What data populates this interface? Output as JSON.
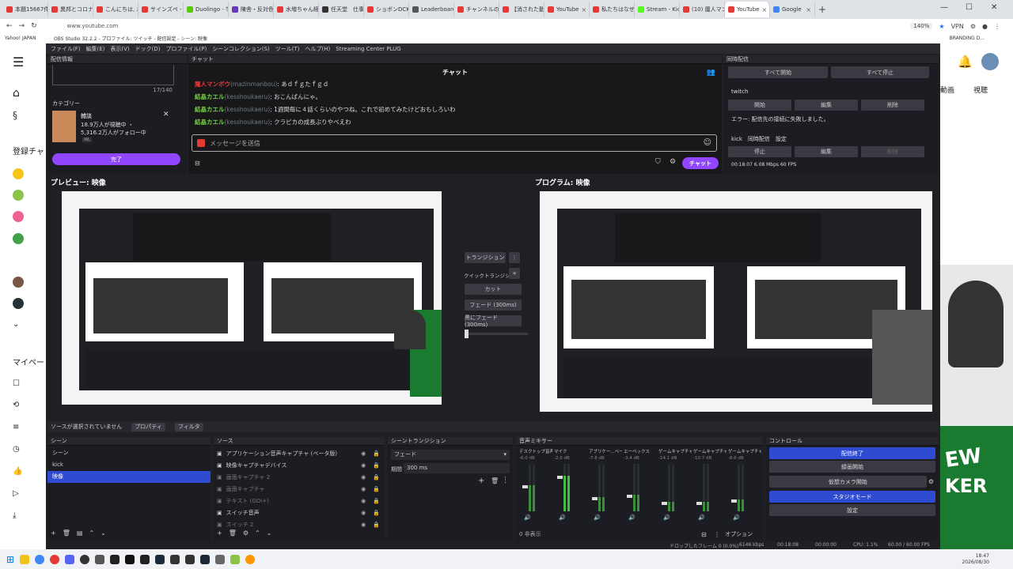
{
  "browser": {
    "tabs": [
      {
        "label": "本題15667件",
        "color": "#e53935"
      },
      {
        "label": "異邦とコロナの遊",
        "color": "#e53935"
      },
      {
        "label": "こんにちは, お手",
        "color": "#e53935"
      },
      {
        "label": "サインズペ - Goo",
        "color": "#e53935"
      },
      {
        "label": "Duolingo - 学習",
        "color": "#58cc02"
      },
      {
        "label": "陳舎・反対色と",
        "color": "#673ab7"
      },
      {
        "label": "水増ちゃん経由",
        "color": "#e53935"
      },
      {
        "label": "任天堂　仕事",
        "color": "#333333"
      },
      {
        "label": "ショボンDCKえンフ",
        "color": "#e53935"
      },
      {
        "label": "Leaderboards | Rua",
        "color": "#555555"
      },
      {
        "label": "チャンネルのコンテ",
        "color": "#e53935"
      },
      {
        "label": "【消された動画】",
        "color": "#e53935"
      },
      {
        "label": "YouTube",
        "color": "#e53935"
      },
      {
        "label": "私たちはなぜま",
        "color": "#e53935"
      },
      {
        "label": "Stream - Kick D",
        "color": "#53fc18"
      },
      {
        "label": "(10) 魔人マンボ",
        "color": "#e53935"
      },
      {
        "label": "YouTube",
        "color": "#e53935"
      },
      {
        "label": "Google",
        "color": "#4285f4"
      }
    ],
    "active_tab": 16,
    "url": "www.youtube.com",
    "zoom": "140%",
    "vpn": "VPN",
    "bookmark_first": "Yahoo! JAPAN",
    "bookmark_right": "BRANDING D..."
  },
  "youtube": {
    "section_subscriptions": "登録チャ",
    "section_mine": "マイペー",
    "right_tabs": [
      "動画",
      "視聴"
    ]
  },
  "obs": {
    "title": "OBS Studio 32.2.2 - プロファイル: ツイッチ - 配信設定 - シーン: 映像",
    "menu": [
      "ファイル(F)",
      "編集(E)",
      "表示(V)",
      "ドック(D)",
      "プロファイル(P)",
      "シーンコレクション(S)",
      "ツール(T)",
      "ヘルプ(H)",
      "Streaming Center PLUG"
    ],
    "stream_info": {
      "dock_title": "配信情報",
      "counter": "17/140",
      "category_label": "カテゴリー",
      "category_name": "雑談",
      "viewers": "18.9万人が視聴中 ・",
      "followers": "5,316.2万人がフォロー中",
      "tag": "IRL",
      "done_label": "完了"
    },
    "chat": {
      "dock_title": "チャット",
      "header": "チャット",
      "messages": [
        {
          "user": "魔人マンボウ",
          "id": "(mazinmanbou)",
          "text": ": あｄｆｇたｆｇｄ"
        },
        {
          "user": "結晶カエル",
          "id": "(kesshoukaeru)",
          "text": ": おこんばんにゃ。"
        },
        {
          "user": "結晶カエル",
          "id": "(kesshoukaeru)",
          "text": ": 1週間毎に４話くらいのやつね。これで初めてみたけどおもしろいわ"
        },
        {
          "user": "結晶カエル",
          "id": "(kesshoukaeru)",
          "text": ": クラピカの成長ぶりやべえわ"
        }
      ],
      "input_placeholder": "メッセージを送信",
      "send_label": "チャット"
    },
    "multistream": {
      "dock_title": "同時配信",
      "start_all": "すべて開始",
      "stop_all": "すべて停止",
      "twitch_label": "twitch",
      "start": "開始",
      "edit": "編集",
      "delete": "削除",
      "error": "エラー: 配信先の接続に失敗しました。",
      "kick_label": "kick　同時配信　設定",
      "stop": "停止",
      "edit2": "編集",
      "delete2": "削除",
      "stats": "00:18:07  6.08 Mbps  60 FPS"
    },
    "preview_label": "プレビュー: 映像",
    "program_label": "プログラム: 映像",
    "transition_panel": {
      "transition": "トランジション",
      "quick": "クイックトランジション",
      "cut": "カット",
      "fade": "フェード (300ms)",
      "black_fade": "黒にフェード (300ms)"
    },
    "source_bar": {
      "no_source": "ソースが選択されていません",
      "properties": "プロパティ",
      "filters": "フィルタ"
    },
    "scenes": {
      "title": "シーン",
      "items": [
        "シーン",
        "kick",
        "映像"
      ],
      "selected": 2
    },
    "sources": {
      "title": "ソース",
      "items": [
        "アプリケーション音声キャプチャ (ベータ版)",
        "映像キャプチャデバイス",
        "画面キャプチャ 2",
        "画面キャプチャ",
        "テキスト (GDI+)",
        "スイッチ音声",
        "スイッチ 2"
      ]
    },
    "scene_transitions": {
      "title": "シーントランジション",
      "type": "フェード",
      "duration_label": "期間",
      "duration": "300 ms"
    },
    "mixer": {
      "title": "音声ミキサー",
      "channels": [
        {
          "name": "デスクトップ音声",
          "db": "-6.0 dB",
          "level": 0.55
        },
        {
          "name": "マイク",
          "db": "-2.0 dB",
          "level": 0.75
        },
        {
          "name": "アプリケー...ベータ版)",
          "db": "-7.8 dB",
          "level": 0.3
        },
        {
          "name": "エーペックス",
          "db": "-3.4 dB",
          "level": 0.35
        },
        {
          "name": "ゲームキャプチャ",
          "db": "-14.1 dB",
          "level": 0.2
        },
        {
          "name": "ゲームキャプチャ 2",
          "db": "-10.7 dB",
          "level": 0.2
        },
        {
          "name": "ゲームキャプチャ",
          "db": "-8.6 dB",
          "level": 0.25
        }
      ],
      "footer": "0 非表示"
    },
    "controls": {
      "title": "コントロール",
      "end_stream": "配信終了",
      "start_recording": "録画開始",
      "virtual_cam": "仮想カメラ開始",
      "studio_mode": "スタジオモード",
      "settings": "設定"
    },
    "statusbar": {
      "dropped": "ドロップしたフレーム 0 (0.0%)",
      "bitrate": "6146 kbps",
      "live_time": "00:18:08",
      "rec_time": "00:00:00",
      "cpu": "CPU: 1.1%",
      "fps": "60.00 / 60.00 FPS"
    },
    "options": "オプション"
  },
  "taskbar": {
    "time": "18:47",
    "date": "2026/08/30"
  }
}
